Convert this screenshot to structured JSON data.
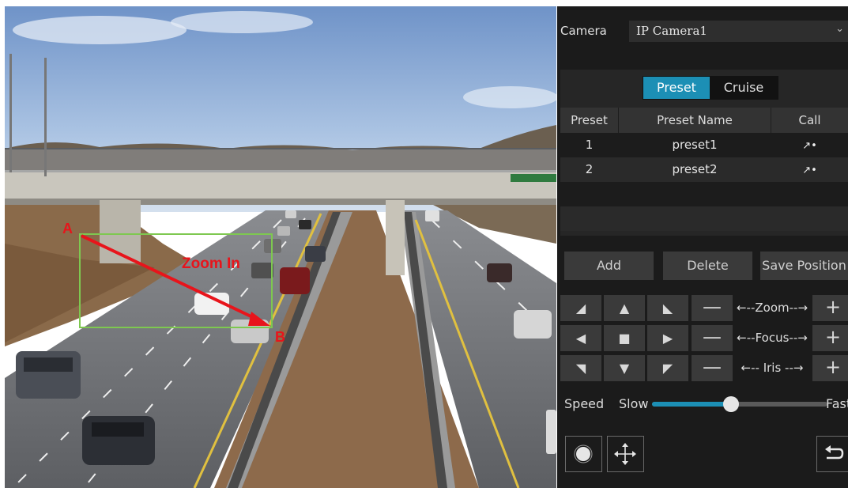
{
  "annotations": {
    "point_a": "A",
    "point_b": "B",
    "zoom_text": "Zoom In"
  },
  "panel": {
    "camera_label": "Camera",
    "camera_value": "IP Camera1",
    "tabs": {
      "preset": "Preset",
      "cruise": "Cruise"
    },
    "table": {
      "headers": {
        "preset": "Preset",
        "name": "Preset Name",
        "call": "Call"
      },
      "rows": [
        {
          "num": "1",
          "name": "preset1"
        },
        {
          "num": "2",
          "name": "preset2"
        }
      ]
    },
    "buttons": {
      "add": "Add",
      "delete": "Delete",
      "save_position": "Save Position"
    },
    "ptz": {
      "zoom_label": "←--Zoom--→",
      "focus_label": "←--Focus--→",
      "iris_label": "←-- Iris --→",
      "minus": "—",
      "plus": "+"
    },
    "speed": {
      "label": "Speed",
      "slow": "Slow",
      "fast": "Fast",
      "level": 0.45
    }
  },
  "colors": {
    "accent": "#1c8fb5",
    "panel_bg": "#1b1b1b",
    "annotation": "#e8141b",
    "zoom_box": "#7ec850"
  }
}
